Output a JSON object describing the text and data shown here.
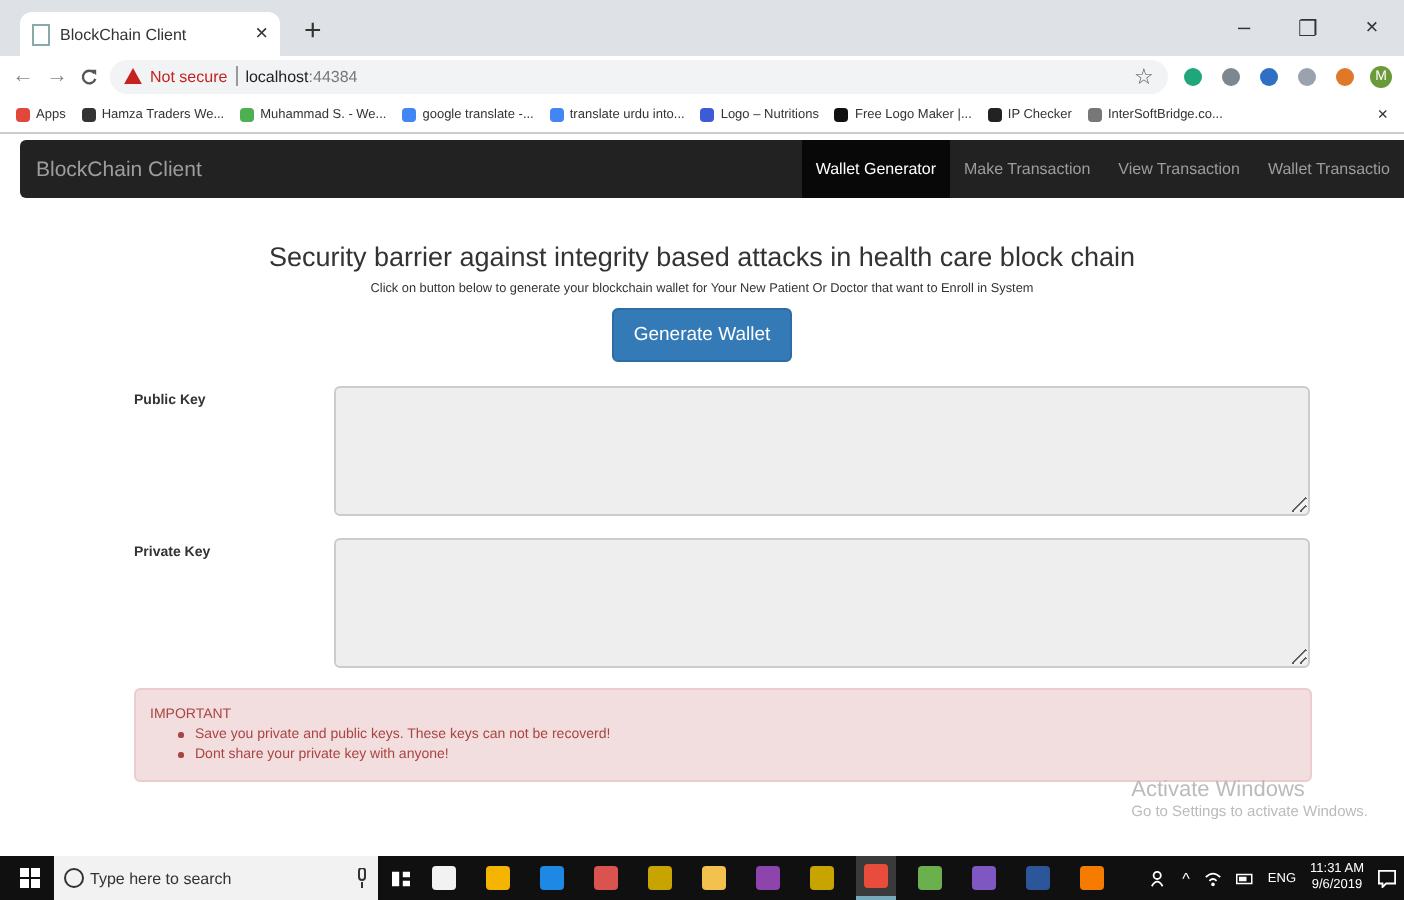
{
  "browser": {
    "tab": {
      "title": "BlockChain Client",
      "close": "×"
    },
    "new_tab": "+",
    "window_controls": [
      "–",
      "❐",
      "×"
    ],
    "nav": {
      "back": "←",
      "forward": "→"
    },
    "security": "Not secure",
    "url_host": "localhost",
    "url_port": ":44384",
    "star": "☆",
    "profile": "M",
    "extensions": [
      {
        "color": "#1fa67a"
      },
      {
        "color": "#7d8790"
      },
      {
        "color": "#2f6fc4"
      },
      {
        "color": "#9aa3ad"
      },
      {
        "color": "#e0782a"
      }
    ],
    "bookmarks": [
      {
        "label": "Apps",
        "color": "#e2483a"
      },
      {
        "label": "Hamza Traders We...",
        "color": "#333333"
      },
      {
        "label": "Muhammad S. - We...",
        "color": "#4caf50"
      },
      {
        "label": "google translate -...",
        "color": "#4285f4"
      },
      {
        "label": "translate urdu into...",
        "color": "#4285f4"
      },
      {
        "label": "Logo – Nutritions",
        "color": "#3d5bd6"
      },
      {
        "label": "Free Logo Maker |...",
        "color": "#111111"
      },
      {
        "label": "IP Checker",
        "color": "#222222"
      },
      {
        "label": "InterSoftBridge.co...",
        "color": "#777777"
      }
    ],
    "bookmarks_close": "×"
  },
  "navbar": {
    "brand": "BlockChain Client",
    "items": [
      {
        "label": "Wallet Generator",
        "selected": true
      },
      {
        "label": "Make Transaction",
        "selected": false
      },
      {
        "label": "View Transaction",
        "selected": false
      },
      {
        "label": "Wallet Transactio",
        "selected": false
      }
    ]
  },
  "main": {
    "title": "Security barrier against integrity based attacks in health care block chain",
    "subtitle": "Click on button below to generate your blockchain wallet for Your New Patient Or Doctor that want to Enroll in System",
    "button": "Generate Wallet",
    "fields": [
      {
        "label": "Public Key"
      },
      {
        "label": "Private Key"
      }
    ],
    "alert": {
      "heading": "IMPORTANT",
      "items": [
        "Save you private and public keys. These keys can not be recoverd!",
        "Dont share your private key with anyone!"
      ]
    }
  },
  "activation": {
    "title": "Activate Windows",
    "hint": "Go to Settings to activate Windows."
  },
  "taskbar": {
    "search_placeholder": "Type here to search",
    "apps": [
      {
        "color": "#f2f2f2",
        "active": false
      },
      {
        "color": "#f4b400",
        "active": false
      },
      {
        "color": "#1e88e5",
        "active": false
      },
      {
        "color": "#d9534f",
        "active": false
      },
      {
        "color": "#c8a400",
        "active": false
      },
      {
        "color": "#f2c14e",
        "active": false
      },
      {
        "color": "#8e44ad",
        "active": false
      },
      {
        "color": "#c8a400",
        "active": false
      },
      {
        "color": "#e84c3d",
        "active": true
      },
      {
        "color": "#6ab04c",
        "active": false
      },
      {
        "color": "#7e57c2",
        "active": false
      },
      {
        "color": "#2b579a",
        "active": false
      },
      {
        "color": "#f57c00",
        "active": false
      }
    ],
    "tray_caret": "^",
    "language": "ENG",
    "time": "11:31 AM",
    "date": "9/6/2019"
  }
}
